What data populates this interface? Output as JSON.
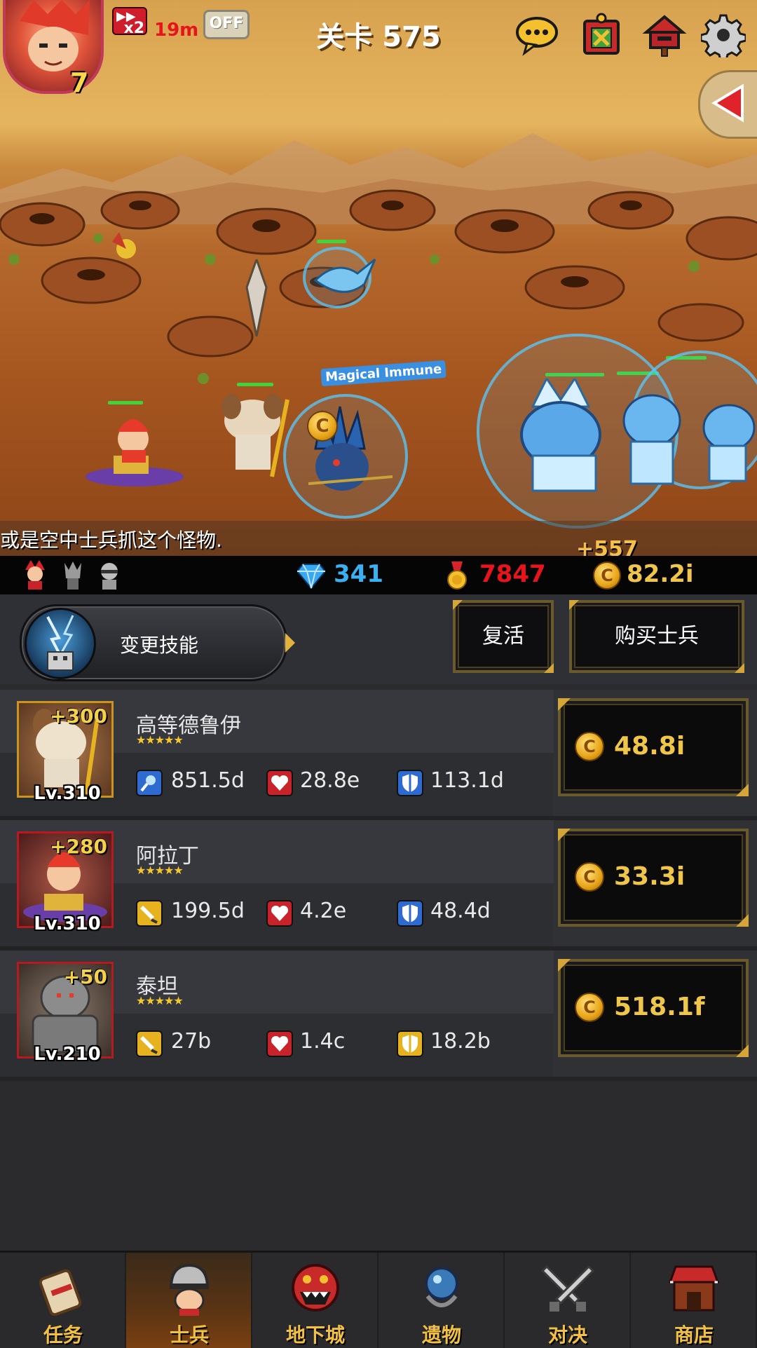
{
  "header": {
    "stage_title": "关卡 575",
    "speed_multiplier": "x2",
    "timer": "19m",
    "auto_toggle": "OFF",
    "player_level": "7"
  },
  "scene": {
    "hint_text": "或是空中士兵抓这个怪物.",
    "magic_text": "Magical Immune",
    "damage_text": "+557"
  },
  "resources": {
    "gems": "341",
    "medals": "7847",
    "gold": "82.2i"
  },
  "actions": {
    "change_skill": "变更技能",
    "revive": "复活",
    "buy_soldier": "购买士兵"
  },
  "units": [
    {
      "name": "高等德鲁伊",
      "stars": "★★★★★",
      "plus": "+300",
      "level": "Lv.310",
      "attack_icon": "magic-staff-icon",
      "attack": "851.5d",
      "hp": "28.8e",
      "defense": "113.1d",
      "price": "48.8i"
    },
    {
      "name": "阿拉丁",
      "stars": "★★★★★",
      "plus": "+280",
      "level": "Lv.310",
      "attack_icon": "sword-icon",
      "attack": "199.5d",
      "hp": "4.2e",
      "defense": "48.4d",
      "price": "33.3i"
    },
    {
      "name": "泰坦",
      "stars": "★★★★★",
      "plus": "+50",
      "level": "Lv.210",
      "attack_icon": "sword-icon",
      "attack": "27b",
      "hp": "1.4c",
      "defense": "18.2b",
      "price": "518.1f"
    }
  ],
  "nav": {
    "tabs": [
      {
        "label": "任务",
        "icon": "scroll-icon",
        "active": false
      },
      {
        "label": "士兵",
        "icon": "knight-helmet-icon",
        "active": true
      },
      {
        "label": "地下城",
        "icon": "monster-icon",
        "active": false
      },
      {
        "label": "遗物",
        "icon": "orb-icon",
        "active": false
      },
      {
        "label": "对决",
        "icon": "crossed-swords-icon",
        "active": false
      },
      {
        "label": "商店",
        "icon": "shop-icon",
        "active": false
      }
    ]
  },
  "colors": {
    "gold_text": "#f0c64a",
    "gem_text": "#3ab0f2",
    "medal_text": "#e8141c",
    "nav_label": "#f2c043"
  }
}
